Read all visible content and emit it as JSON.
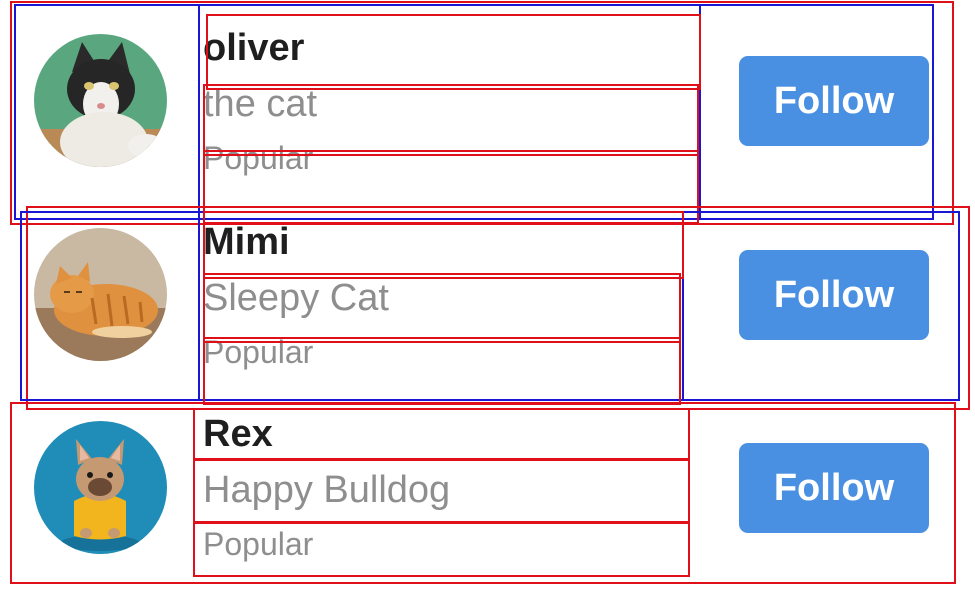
{
  "users": [
    {
      "name": "oliver",
      "subtitle": "the cat",
      "tag": "Popular",
      "follow_label": "Follow"
    },
    {
      "name": "Mimi",
      "subtitle": "Sleepy Cat",
      "tag": "Popular",
      "follow_label": "Follow"
    },
    {
      "name": "Rex",
      "subtitle": "Happy Bulldog",
      "tag": "Popular",
      "follow_label": "Follow"
    }
  ],
  "colors": {
    "button_bg": "#4990e2",
    "button_text": "#ffffff",
    "name_text": "#1f1f1f",
    "secondary_text": "#8e8e8e",
    "debug_red": "#e0101b",
    "debug_blue": "#1a17d4"
  }
}
